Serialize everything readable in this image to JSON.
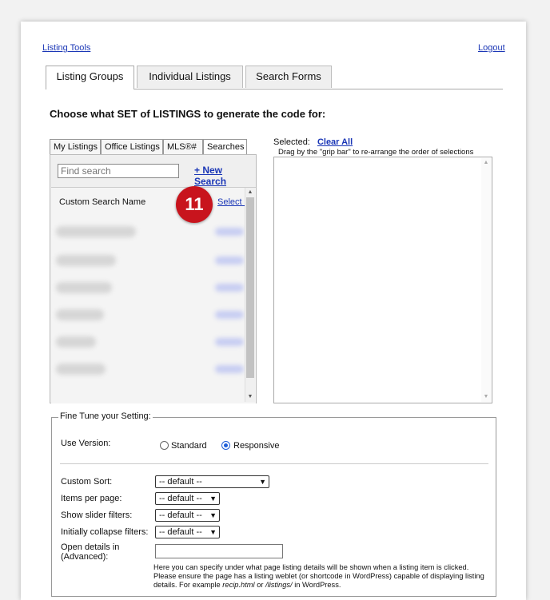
{
  "header": {
    "listing_tools": "Listing Tools",
    "logout": "Logout"
  },
  "tabs": [
    {
      "label": "Listing Groups"
    },
    {
      "label": "Individual Listings"
    },
    {
      "label": "Search Forms"
    }
  ],
  "heading": "Choose what SET of LISTINGS to generate the code for:",
  "subtabs": [
    {
      "label": "My Listings"
    },
    {
      "label": "Office Listings"
    },
    {
      "label": "MLS®#"
    },
    {
      "label": "Searches"
    }
  ],
  "search": {
    "placeholder": "Find search",
    "new_search": "+ New Search"
  },
  "list": {
    "first_row": "Custom Search Name",
    "select_label": "Select »",
    "badge": "11"
  },
  "selected": {
    "label": "Selected:",
    "clear_all": "Clear All",
    "note": "Drag by the \"grip bar\" to re-arrange the order of selections"
  },
  "fine_tune": {
    "legend": "Fine Tune your Setting:",
    "use_version": "Use Version:",
    "standard": "Standard",
    "responsive": "Responsive",
    "custom_sort": "Custom Sort:",
    "custom_sort_value": "-- default --",
    "items_per_page": "Items per page:",
    "items_per_page_value": "-- default --",
    "show_slider": "Show slider filters:",
    "show_slider_value": "-- default --",
    "collapse": "Initially collapse filters:",
    "collapse_value": "-- default --",
    "open_details_1": "Open details in",
    "open_details_2": "(Advanced):",
    "note_1": "Here you can specify under what page listing details will be shown when a listing item is clicked. Please ensure the page has a listing weblet (or shortcode in WordPress) capable of displaying listing details. For example ",
    "note_ex1": "recip.html",
    "note_or": " or ",
    "note_ex2": "/listings/",
    "note_end": " in WordPress."
  }
}
